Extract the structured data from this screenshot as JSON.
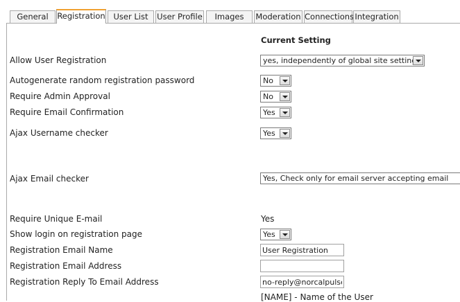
{
  "tabs": [
    {
      "label": "General"
    },
    {
      "label": "Registration"
    },
    {
      "label": "User List"
    },
    {
      "label": "User Profile"
    },
    {
      "label": "Images"
    },
    {
      "label": "Moderation"
    },
    {
      "label": "Connections"
    },
    {
      "label": "Integration"
    }
  ],
  "header": {
    "current_setting": "Current Setting"
  },
  "settings": {
    "allow_registration": {
      "label": "Allow User Registration",
      "value": "yes, independently of global site setting"
    },
    "autogen_password": {
      "label": "Autogenerate random registration password",
      "value": "No"
    },
    "admin_approval": {
      "label": "Require Admin Approval",
      "value": "No"
    },
    "email_confirmation": {
      "label": "Require Email Confirmation",
      "value": "Yes"
    },
    "ajax_username": {
      "label": "Ajax Username checker",
      "value": "Yes"
    },
    "ajax_email": {
      "label": "Ajax Email checker",
      "value": "Yes, Check only for email server accepting email"
    },
    "unique_email": {
      "label": "Require Unique E-mail",
      "value": "Yes"
    },
    "show_login": {
      "label": "Show login on registration page",
      "value": "Yes"
    },
    "email_name": {
      "label": "Registration Email Name",
      "value": "User Registration"
    },
    "email_address": {
      "label": "Registration Email Address",
      "value": ""
    },
    "reply_to": {
      "label": "Registration Reply To Email Address",
      "value": "no-reply@norcalpulse.com"
    }
  },
  "hint": {
    "name_token": "[NAME] - Name of the User"
  }
}
